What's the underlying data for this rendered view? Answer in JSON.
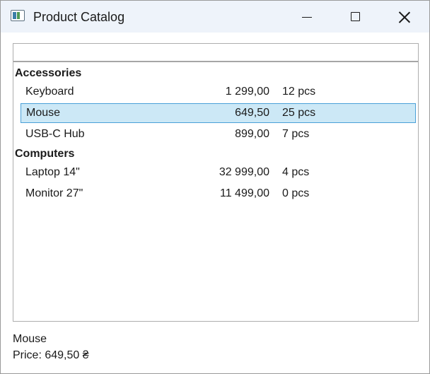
{
  "window": {
    "title": "Product Catalog",
    "icon": "app-window-icon"
  },
  "controls": {
    "minimize_icon": "minimize-icon",
    "maximize_icon": "maximize-icon",
    "close_icon": "close-icon"
  },
  "list": {
    "header": "",
    "groups": [
      {
        "name": "Accessories",
        "items": [
          {
            "name": "Keyboard",
            "price": "1 299,00",
            "qty": "12 pcs"
          },
          {
            "name": "Mouse",
            "price": "649,50",
            "qty": "25 pcs",
            "selected": true
          },
          {
            "name": "USB-C Hub",
            "price": "899,00",
            "qty": "7 pcs"
          }
        ]
      },
      {
        "name": "Computers",
        "items": [
          {
            "name": "Laptop 14\"",
            "price": "32 999,00",
            "qty": "4 pcs"
          },
          {
            "name": "Monitor 27\"",
            "price": "11 499,00",
            "qty": "0 pcs"
          }
        ]
      }
    ]
  },
  "details": {
    "name": "Mouse",
    "price_line": "Price: 649,50 ₴"
  },
  "colors": {
    "selection_bg": "#cce8f6",
    "selection_border": "#4aa0d8",
    "titlebar_bg": "#eef3fa"
  }
}
